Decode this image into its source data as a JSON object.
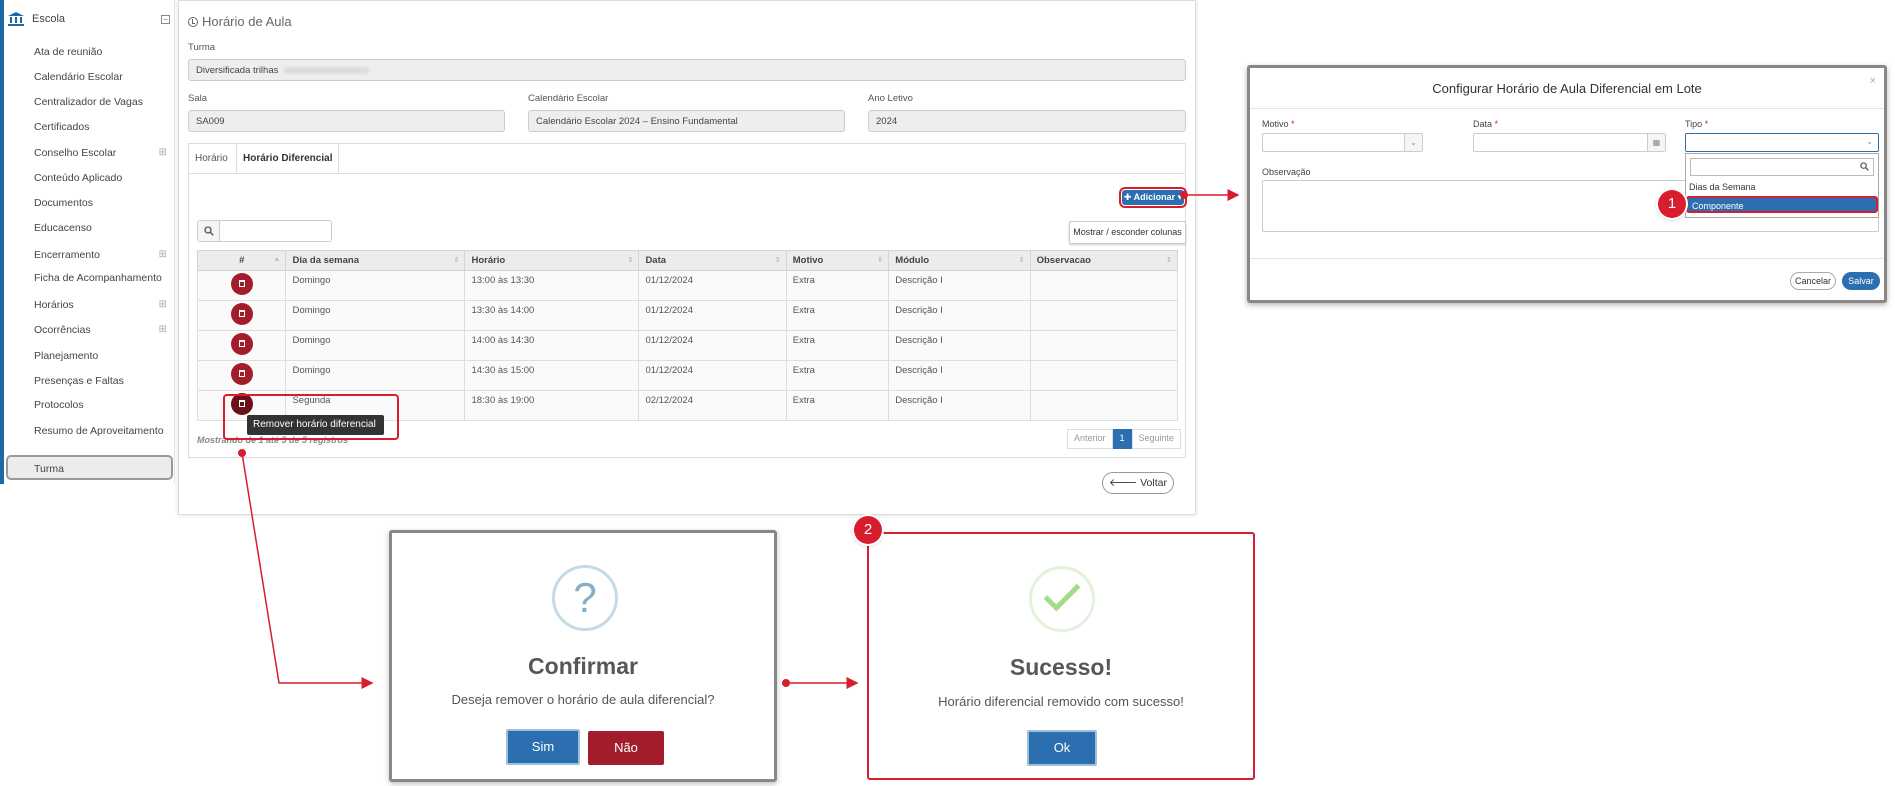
{
  "sidebar": {
    "header": "Escola",
    "items": [
      {
        "label": "Ata de reunião",
        "expandable": false
      },
      {
        "label": "Calendário Escolar",
        "expandable": false
      },
      {
        "label": "Centralizador de Vagas",
        "expandable": false
      },
      {
        "label": "Certificados",
        "expandable": false
      },
      {
        "label": "Conselho Escolar",
        "expandable": true
      },
      {
        "label": "Conteúdo Aplicado",
        "expandable": false
      },
      {
        "label": "Documentos",
        "expandable": false
      },
      {
        "label": "Educacenso",
        "expandable": false
      },
      {
        "label": "Encerramento",
        "expandable": true
      },
      {
        "label": "Ficha de Acompanhamento",
        "expandable": false
      },
      {
        "label": "Horários",
        "expandable": true
      },
      {
        "label": "Ocorrências",
        "expandable": true
      },
      {
        "label": "Planejamento",
        "expandable": false
      },
      {
        "label": "Presenças e Faltas",
        "expandable": false
      },
      {
        "label": "Protocolos",
        "expandable": false
      },
      {
        "label": "Resumo de Aproveitamento",
        "expandable": false
      },
      {
        "label": "Turma",
        "expandable": false,
        "active": true
      }
    ]
  },
  "main": {
    "title": "Horário de Aula",
    "turma_label": "Turma",
    "turma_value": "Diversificada trilhas",
    "sala_label": "Sala",
    "sala_value": "SA009",
    "calendario_label": "Calendário Escolar",
    "calendario_value": "Calendário Escolar 2024 – Ensino Fundamental",
    "ano_label": "Ano Letivo",
    "ano_value": "2024",
    "tabs": [
      "Horário",
      "Horário Diferencial"
    ],
    "add_button": "Adicionar",
    "columns_button": "Mostrar / esconder colunas",
    "table": {
      "headers": [
        "#",
        "Dia da semana",
        "Horário",
        "Data",
        "Motivo",
        "Módulo",
        "Observacao"
      ],
      "rows": [
        [
          "Domingo",
          "13:00 às 13:30",
          "01/12/2024",
          "Extra",
          "Descrição I",
          ""
        ],
        [
          "Domingo",
          "13:30 às 14:00",
          "01/12/2024",
          "Extra",
          "Descrição I",
          ""
        ],
        [
          "Domingo",
          "14:00 às 14:30",
          "01/12/2024",
          "Extra",
          "Descrição I",
          ""
        ],
        [
          "Domingo",
          "14:30 às 15:00",
          "01/12/2024",
          "Extra",
          "Descrição I",
          ""
        ],
        [
          "Segunda",
          "18:30 às 19:00",
          "02/12/2024",
          "Extra",
          "Descrição I",
          ""
        ]
      ]
    },
    "showing": "Mostrando de 1 até 5 de 5 registros",
    "pager": {
      "prev": "Anterior",
      "current": "1",
      "next": "Seguinte"
    },
    "back_button": "Voltar",
    "tooltip": "Remover horário diferencial"
  },
  "config_modal": {
    "title": "Configurar Horário de Aula Diferencial em Lote",
    "close": "×",
    "motivo_label": "Motivo",
    "data_label": "Data",
    "tipo_label": "Tipo",
    "required_mark": "*",
    "observacao_label": "Observação",
    "tipo_options": [
      "Dias da Semana",
      "Componente"
    ],
    "cancel_button": "Cancelar",
    "save_button": "Salvar"
  },
  "badges": [
    "1",
    "2"
  ],
  "confirm_dialog": {
    "icon": "?",
    "title": "Confirmar",
    "text": "Deseja remover o horário de aula diferencial?",
    "yes": "Sim",
    "no": "Não"
  },
  "success_dialog": {
    "title": "Sucesso!",
    "text": "Horário diferencial removido com sucesso!",
    "ok": "Ok"
  },
  "colors": {
    "primary": "#2c6fb0",
    "danger": "#a31c2c",
    "highlight": "#d81e2d",
    "success_check": "#a5dc86"
  }
}
